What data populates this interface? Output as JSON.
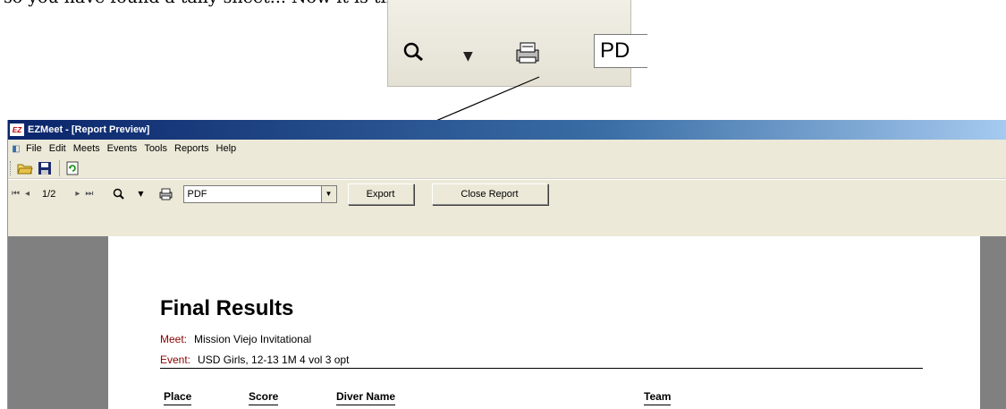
{
  "caption": "so you have found a tally sheet... Now it is time...",
  "inset": {
    "format_value": "PD",
    "icons": [
      "magnifier-icon",
      "chevron-down-icon",
      "printer-icon"
    ]
  },
  "window": {
    "title": "EZMeet - [Report Preview]",
    "app_icon_text": "EZ",
    "menu": [
      "File",
      "Edit",
      "Meets",
      "Events",
      "Tools",
      "Reports",
      "Help"
    ],
    "toolbar_icons": [
      "open-folder-icon",
      "save-icon",
      "refresh-icon"
    ],
    "report_toolbar": {
      "page_indicator": "1/2",
      "format_value": "PDF",
      "export_label": "Export",
      "close_label": "Close Report"
    }
  },
  "report": {
    "title": "Final Results",
    "meet_label": "Meet:",
    "meet_value": "Mission Viejo Invitational",
    "event_label": "Event:",
    "event_value": "USD Girls, 12-13 1M 4 vol 3 opt",
    "columns": [
      "Place",
      "Score",
      "Diver Name",
      "Team"
    ]
  },
  "colors": {
    "titlebar_start": "#0a246a",
    "titlebar_end": "#a6caf0",
    "label_red": "#8b0000",
    "chrome": "#ece9d8",
    "preview_bg": "#808080"
  }
}
